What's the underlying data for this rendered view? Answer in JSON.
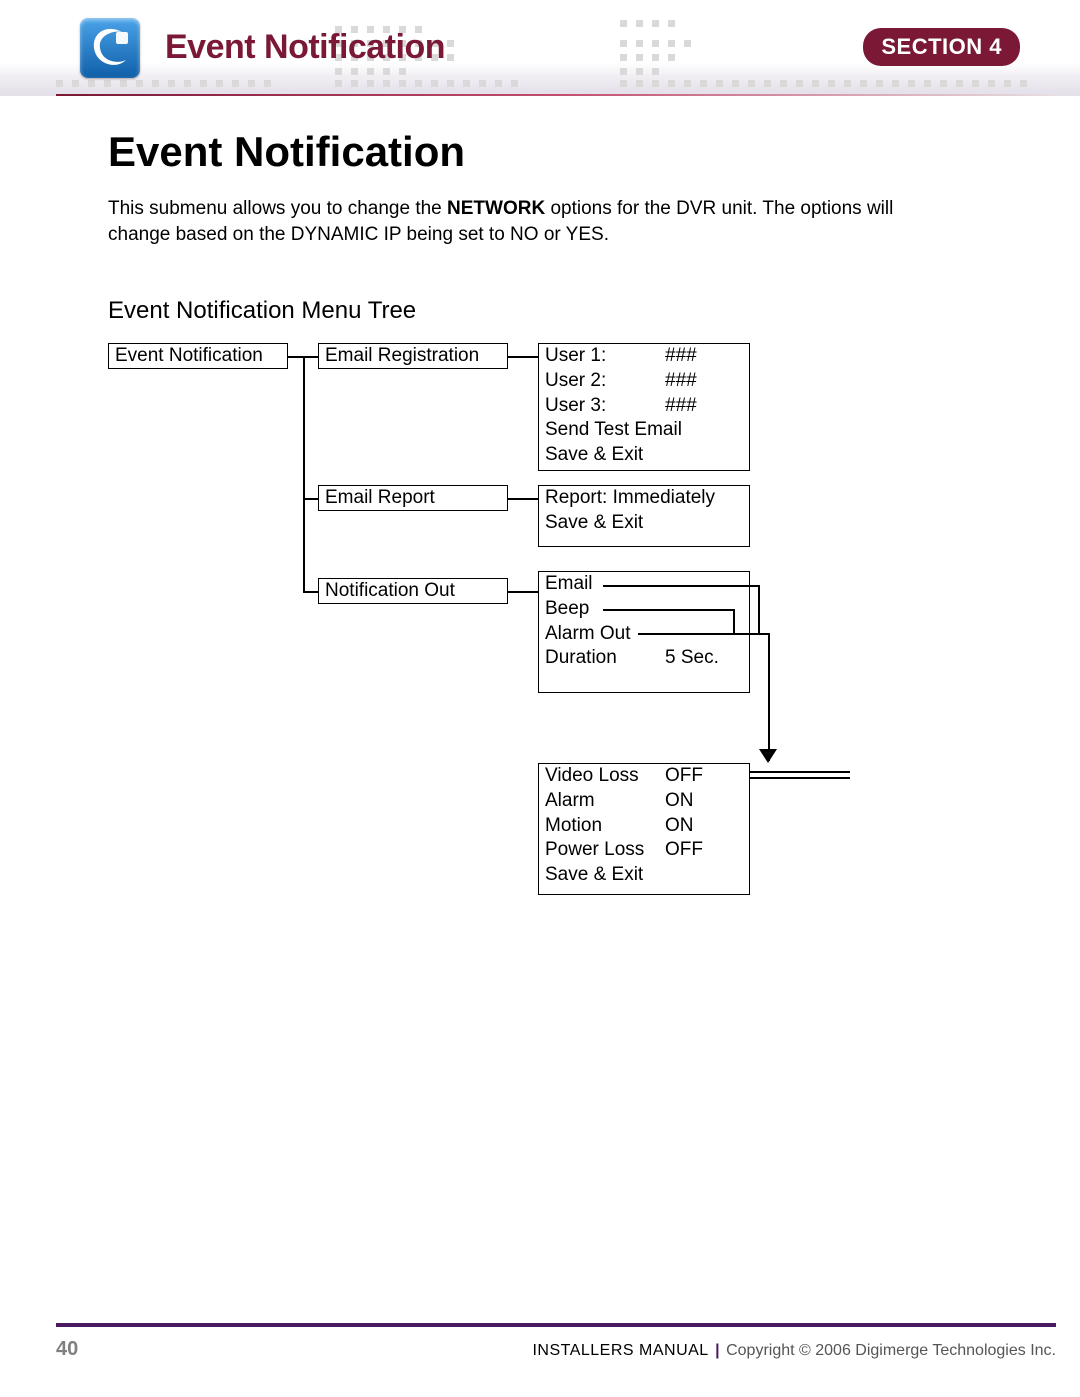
{
  "header": {
    "title": "Event Notification",
    "section_label": "SECTION 4"
  },
  "content": {
    "title": "Event Notification",
    "intro_prefix": "This submenu allows you to change the ",
    "intro_bold": "NETWORK",
    "intro_suffix": " options for the DVR unit. The options will change based on the DYNAMIC IP being set to NO or YES.",
    "subhead": "Event Notification Menu Tree"
  },
  "diagram": {
    "root": "Event Notification",
    "branch1": {
      "label": "Email Registration",
      "items": [
        {
          "key": "User 1:",
          "val": "###"
        },
        {
          "key": "User 2:",
          "val": "###"
        },
        {
          "key": "User 3:",
          "val": "###"
        }
      ],
      "extra1": "Send Test Email",
      "extra2": "Save & Exit"
    },
    "branch2": {
      "label": "Email Report",
      "line1": "Report: Immediately",
      "line2": "Save & Exit"
    },
    "branch3": {
      "label": "Notification Out",
      "line1": "Email",
      "line2": "Beep",
      "line3": "Alarm Out",
      "line4_key": "Duration",
      "line4_val": "5 Sec."
    },
    "sub": {
      "items": [
        {
          "key": "Video Loss",
          "val": "OFF"
        },
        {
          "key": "Alarm",
          "val": "ON"
        },
        {
          "key": "Motion",
          "val": "ON"
        },
        {
          "key": "Power Loss",
          "val": "OFF"
        }
      ],
      "save": "Save & Exit"
    }
  },
  "footer": {
    "page": "40",
    "manual": "INSTALLERS MANUAL",
    "copyright": "Copyright © 2006 Digimerge Technologies Inc."
  }
}
